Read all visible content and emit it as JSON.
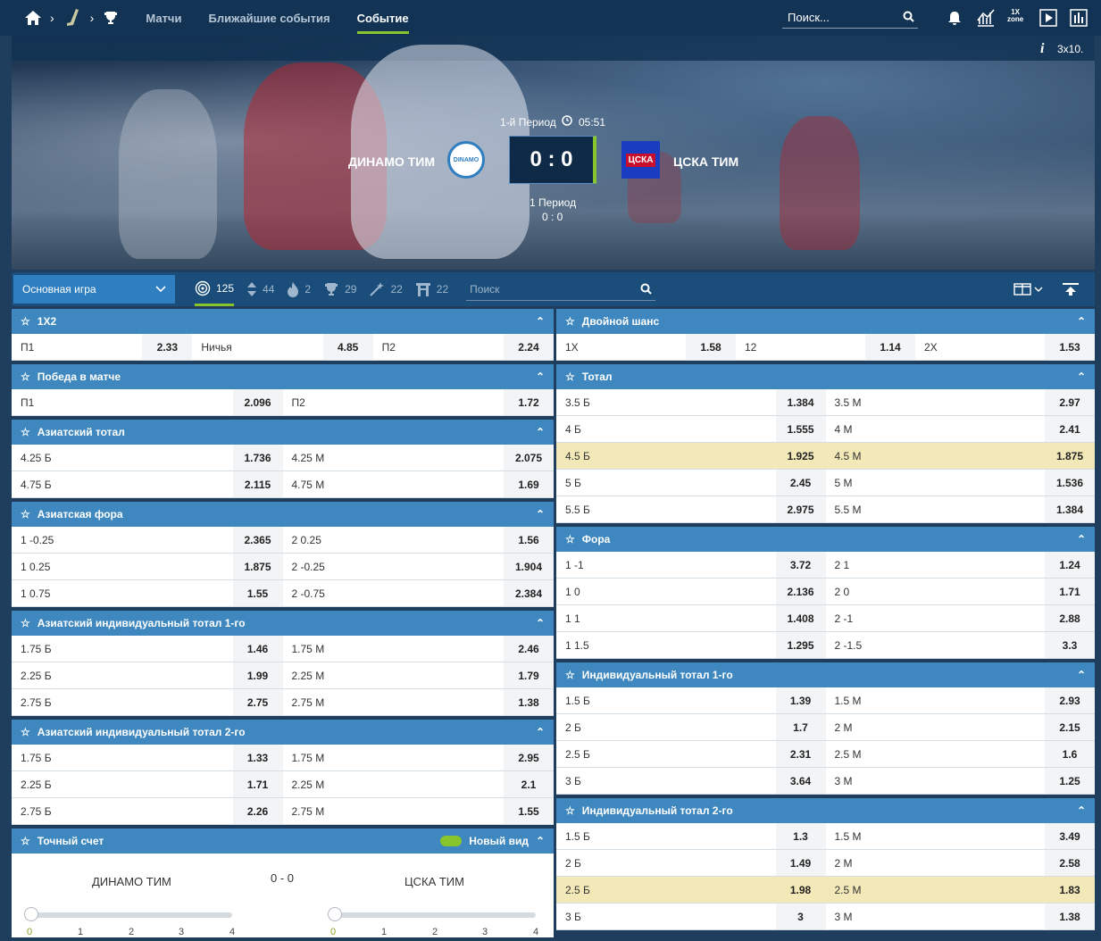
{
  "nav": {
    "links": [
      "Матчи",
      "Ближайшие события",
      "Событие"
    ],
    "search_placeholder": "Поиск...",
    "info_text": "3x10."
  },
  "event": {
    "period_label": "1-й Период",
    "clock": "05:51",
    "team1": "ДИНАМО ТИМ",
    "team2": "ЦСКА ТИМ",
    "team1_logo_text": "DINAMO",
    "team2_logo_text": "ЦСКА",
    "score": "0 : 0",
    "sub_period": "1 Период",
    "sub_score": "0 : 0"
  },
  "filters": {
    "dropdown": "Основная игра",
    "counts": [
      {
        "icon": "target-icon",
        "value": "125"
      },
      {
        "icon": "sort-icon",
        "value": "44"
      },
      {
        "icon": "fire-icon",
        "value": "2"
      },
      {
        "icon": "trophy-icon",
        "value": "29"
      },
      {
        "icon": "wand-icon",
        "value": "22"
      },
      {
        "icon": "gate-icon",
        "value": "22"
      }
    ],
    "search_placeholder": "Поиск"
  },
  "left": [
    {
      "title": "1X2",
      "rows": [
        [
          "П1",
          "2.33",
          "Ничья",
          "4.85",
          "П2",
          "2.24"
        ]
      ]
    },
    {
      "title": "Победа в матче",
      "rows": [
        [
          "П1",
          "2.096",
          "П2",
          "1.72"
        ]
      ]
    },
    {
      "title": "Азиатский тотал",
      "rows": [
        [
          "4.25 Б",
          "1.736",
          "4.25 М",
          "2.075"
        ],
        [
          "4.75 Б",
          "2.115",
          "4.75 М",
          "1.69"
        ]
      ]
    },
    {
      "title": "Азиатская фора",
      "rows": [
        [
          "1 -0.25",
          "2.365",
          "2 0.25",
          "1.56"
        ],
        [
          "1 0.25",
          "1.875",
          "2 -0.25",
          "1.904"
        ],
        [
          "1 0.75",
          "1.55",
          "2 -0.75",
          "2.384"
        ]
      ]
    },
    {
      "title": "Азиатский индивидуальный тотал 1-го",
      "rows": [
        [
          "1.75 Б",
          "1.46",
          "1.75 М",
          "2.46"
        ],
        [
          "2.25 Б",
          "1.99",
          "2.25 М",
          "1.79"
        ],
        [
          "2.75 Б",
          "2.75",
          "2.75 М",
          "1.38"
        ]
      ]
    },
    {
      "title": "Азиатский индивидуальный тотал 2-го",
      "rows": [
        [
          "1.75 Б",
          "1.33",
          "1.75 М",
          "2.95"
        ],
        [
          "2.25 Б",
          "1.71",
          "2.25 М",
          "2.1"
        ],
        [
          "2.75 Б",
          "2.26",
          "2.75 М",
          "1.55"
        ]
      ]
    }
  ],
  "exact_score": {
    "title": "Точный счет",
    "new_view": "Новый вид",
    "team1": "ДИНАМО ТИМ",
    "team2": "ЦСКА ТИМ",
    "score": "0 - 0",
    "ticks": [
      "0",
      "1",
      "2",
      "3",
      "4"
    ]
  },
  "right": [
    {
      "title": "Двойной шанс",
      "rows": [
        [
          "1X",
          "1.58",
          "12",
          "1.14",
          "2X",
          "1.53"
        ]
      ]
    },
    {
      "title": "Тотал",
      "rows": [
        [
          "3.5 Б",
          "1.384",
          "3.5 М",
          "2.97"
        ],
        [
          "4 Б",
          "1.555",
          "4 М",
          "2.41"
        ],
        [
          "4.5 Б",
          "1.925",
          "4.5 М",
          "1.875"
        ],
        [
          "5 Б",
          "2.45",
          "5 М",
          "1.536"
        ],
        [
          "5.5 Б",
          "2.975",
          "5.5 М",
          "1.384"
        ]
      ],
      "highlight": 2
    },
    {
      "title": "Фора",
      "rows": [
        [
          "1 -1",
          "3.72",
          "2 1",
          "1.24"
        ],
        [
          "1 0",
          "2.136",
          "2 0",
          "1.71"
        ],
        [
          "1 1",
          "1.408",
          "2 -1",
          "2.88"
        ],
        [
          "1 1.5",
          "1.295",
          "2 -1.5",
          "3.3"
        ]
      ]
    },
    {
      "title": "Индивидуальный тотал 1-го",
      "rows": [
        [
          "1.5 Б",
          "1.39",
          "1.5 М",
          "2.93"
        ],
        [
          "2 Б",
          "1.7",
          "2 М",
          "2.15"
        ],
        [
          "2.5 Б",
          "2.31",
          "2.5 М",
          "1.6"
        ],
        [
          "3 Б",
          "3.64",
          "3 М",
          "1.25"
        ]
      ]
    },
    {
      "title": "Индивидуальный тотал 2-го",
      "rows": [
        [
          "1.5 Б",
          "1.3",
          "1.5 М",
          "3.49"
        ],
        [
          "2 Б",
          "1.49",
          "2 М",
          "2.58"
        ],
        [
          "2.5 Б",
          "1.98",
          "2.5 М",
          "1.83"
        ],
        [
          "3 Б",
          "3",
          "3 М",
          "1.38"
        ]
      ],
      "highlight": 2
    }
  ],
  "colors": {
    "accent": "#88c42c",
    "header": "#3e87bf",
    "nav": "#123354",
    "highlight": "#f3e9b8"
  }
}
